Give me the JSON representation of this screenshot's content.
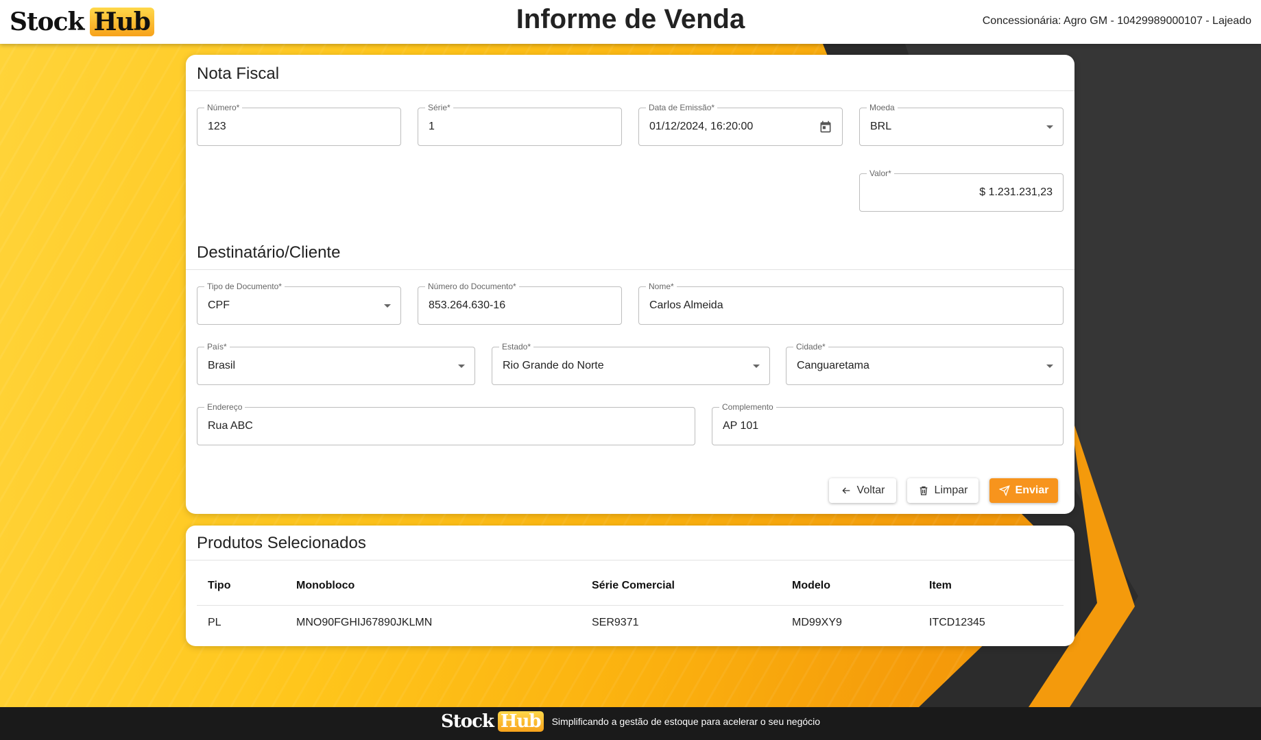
{
  "header": {
    "logo_stock": "Stock",
    "logo_hub": "Hub",
    "title": "Informe de Venda",
    "dealer": "Concessionária: Agro GM - 10429989000107 - Lajeado"
  },
  "nota_fiscal": {
    "title": "Nota Fiscal",
    "numero": {
      "label": "Número*",
      "value": "123"
    },
    "serie": {
      "label": "Série*",
      "value": "1"
    },
    "data_emissao": {
      "label": "Data de Emissão*",
      "value": "01/12/2024, 16:20:00",
      "icon": "calendar-icon"
    },
    "moeda": {
      "label": "Moeda",
      "value": "BRL"
    },
    "valor": {
      "label": "Valor*",
      "value": "$ 1.231.231,23"
    }
  },
  "destinatario": {
    "title": "Destinatário/Cliente",
    "tipo_documento": {
      "label": "Tipo de Documento*",
      "value": "CPF"
    },
    "numero_documento": {
      "label": "Número do Documento*",
      "value": "853.264.630-16"
    },
    "nome": {
      "label": "Nome*",
      "value": "Carlos Almeida"
    },
    "pais": {
      "label": "País*",
      "value": "Brasil"
    },
    "estado": {
      "label": "Estado*",
      "value": "Rio Grande do Norte"
    },
    "cidade": {
      "label": "Cidade*",
      "value": "Canguaretama"
    },
    "endereco": {
      "label": "Endereço",
      "value": "Rua ABC"
    },
    "complemento": {
      "label": "Complemento",
      "value": "AP 101"
    }
  },
  "actions": {
    "voltar": "Voltar",
    "limpar": "Limpar",
    "enviar": "Enviar"
  },
  "produtos": {
    "title": "Produtos Selecionados",
    "columns": [
      "Tipo",
      "Monobloco",
      "Série Comercial",
      "Modelo",
      "Item"
    ],
    "rows": [
      [
        "PL",
        "MNO90FGHIJ67890JKLMN",
        "SER9371",
        "MD99XY9",
        "ITCD12345"
      ]
    ]
  },
  "footer": {
    "logo_stock": "Stock",
    "logo_hub": "Hub",
    "tagline": "Simplificando a gestão de estoque para acelerar o seu negócio"
  },
  "colors": {
    "primary": "#f7941d",
    "background": "#f8b812",
    "footer": "#1a1a1a"
  }
}
